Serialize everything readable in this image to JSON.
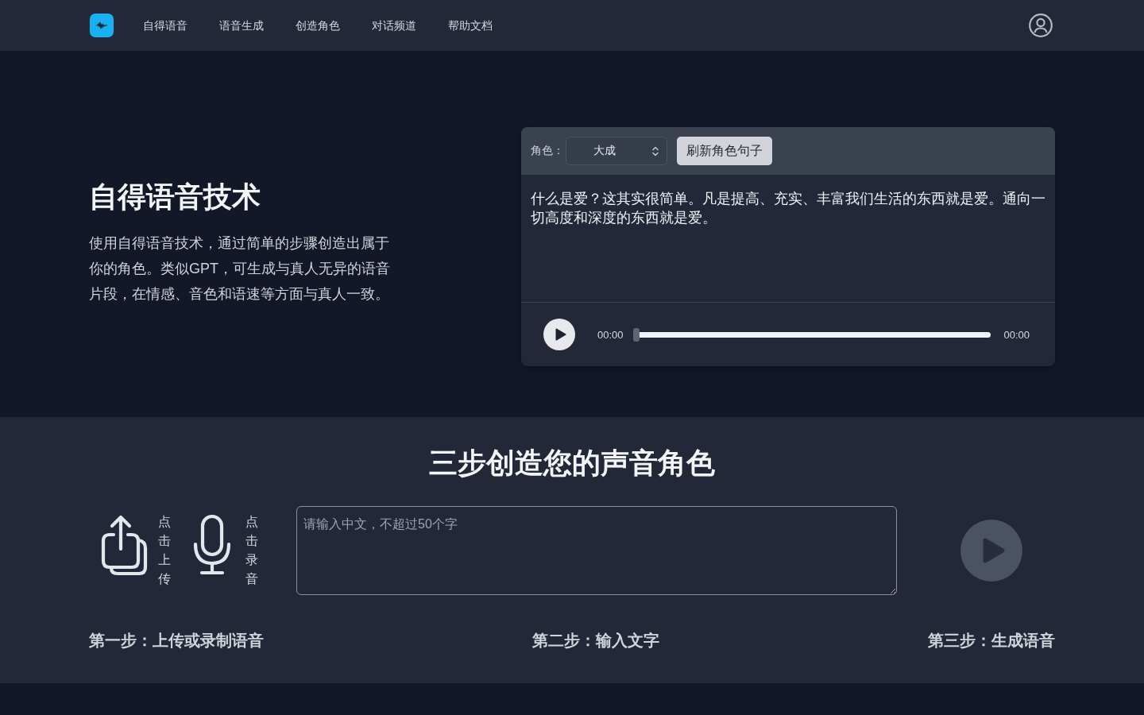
{
  "nav": {
    "links": [
      "自得语音",
      "语音生成",
      "创造角色",
      "对话频道",
      "帮助文档"
    ]
  },
  "hero": {
    "title": "自得语音技术",
    "description": "使用自得语音技术，通过简单的步骤创造出属于你的角色。类似GPT，可生成与真人无异的语音片段，在情感、音色和语速等方面与真人一致。"
  },
  "demo_card": {
    "role_label": "角色：",
    "role_select": {
      "value": "大成"
    },
    "refresh_button": "刷新角色句子",
    "sentence": "什么是爱？这其实很简单。凡是提高、充实、丰富我们生活的东西就是爱。通向一切高度和深度的东西就是爱。",
    "player": {
      "current_time": "00:00",
      "duration": "00:00",
      "level": 0
    }
  },
  "steps_section": {
    "title": "三步创造您的声音角色",
    "upload_button": "点击上传",
    "record_button": "点击录音",
    "text_input": {
      "placeholder": "请输入中文，不超过50个字"
    },
    "generate_button": {
      "disabled": true
    },
    "steps": [
      "第一步：上传或录制语音",
      "第二步：输入文字",
      "第三步：生成语音"
    ]
  }
}
